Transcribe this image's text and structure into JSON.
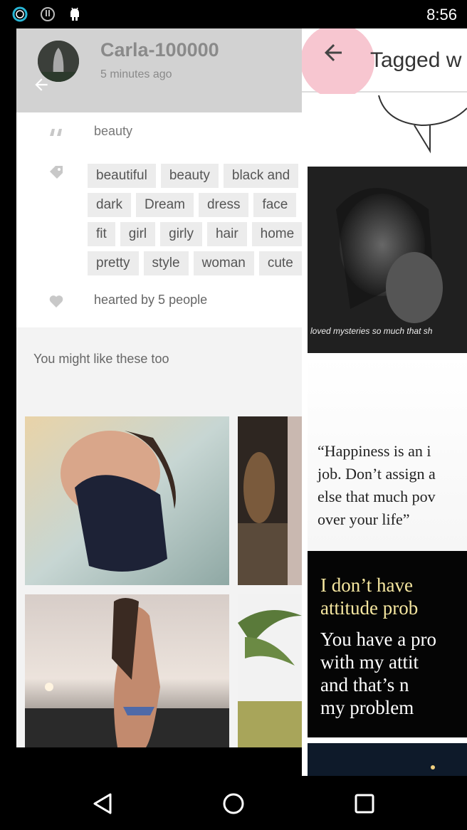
{
  "status_bar": {
    "time": "8:56",
    "icons": [
      "ring-icon",
      "alert-circle-icon",
      "android-icon"
    ]
  },
  "post": {
    "username": "Carla-100000",
    "timestamp": "5 minutes ago",
    "caption": "beauty",
    "tags": [
      [
        "beautiful",
        "beauty",
        "black and"
      ],
      [
        "dark",
        "Dream",
        "dress",
        "face"
      ],
      [
        "fit",
        "girl",
        "girly",
        "hair",
        "home"
      ],
      [
        "pretty",
        "style",
        "woman",
        "cute"
      ]
    ],
    "hearted": "hearted by 5 people",
    "suggest_title": "You might like these too"
  },
  "right_panel": {
    "title": "Tagged w",
    "photo_caption": "loved mysteries so much that sh",
    "quote1": [
      "“Happiness is an i",
      "job. Don’t assign a",
      "else that much pov",
      "over your life”"
    ],
    "quote2": [
      "I don’t have",
      "attitude prob",
      "You have a pro",
      "with my attit",
      "and that’s n",
      "my problem"
    ]
  },
  "colors": {
    "header_gray": "#d2d2d2",
    "back_accent": "#f7c6d0",
    "tag_bg": "#ececec"
  }
}
